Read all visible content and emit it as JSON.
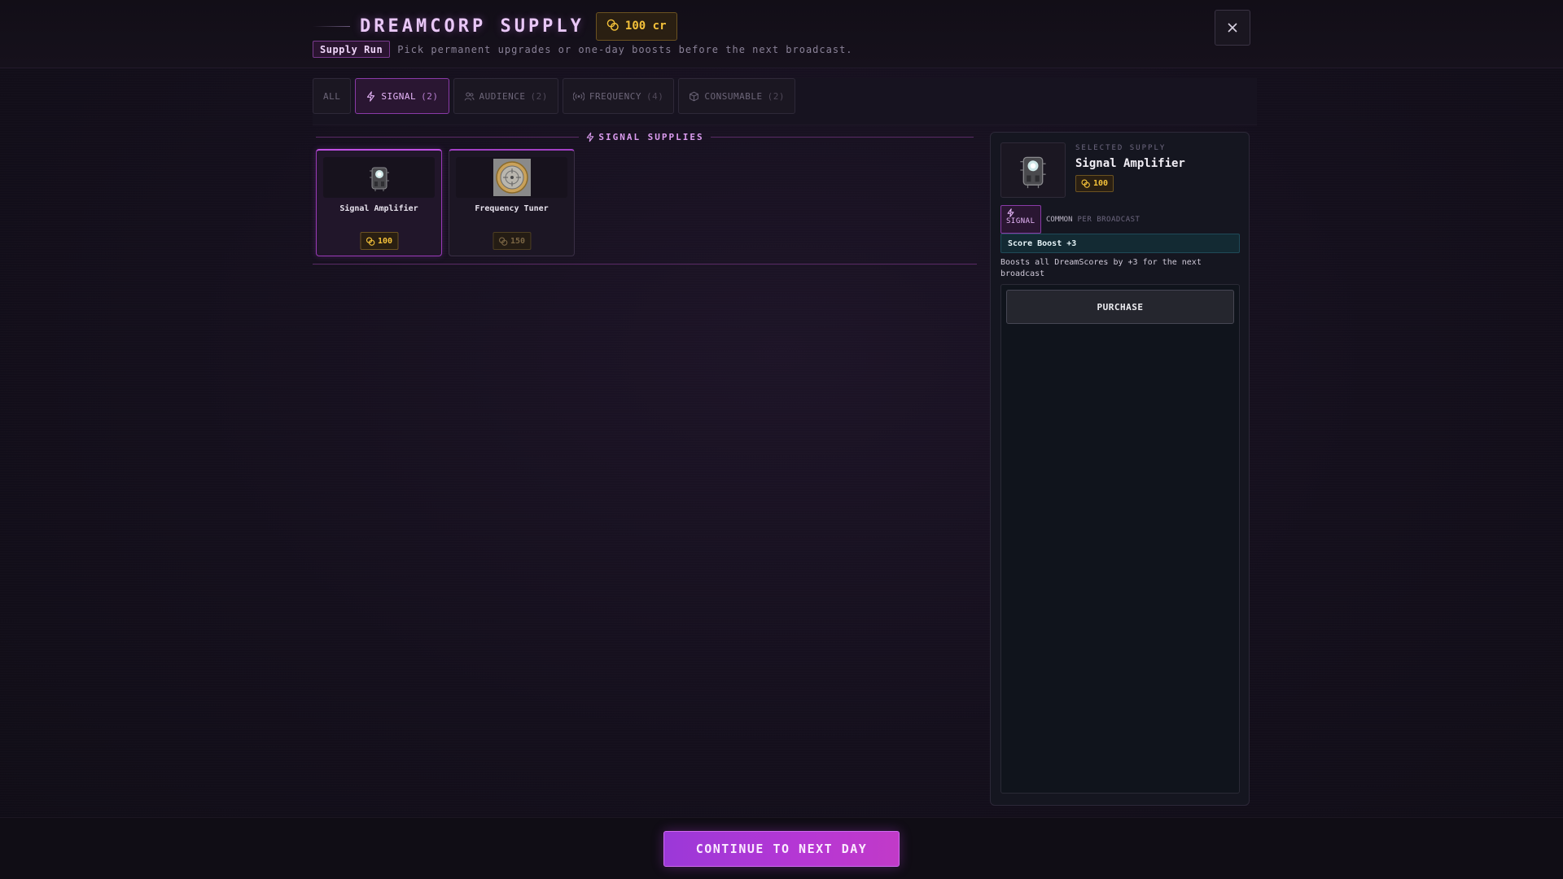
{
  "header": {
    "title": "DREAMCORP SUPPLY",
    "credits": "100 cr",
    "mode_badge": "Supply Run",
    "subtitle": "Pick permanent upgrades or one-day boosts before the next broadcast.",
    "close_label": "✕"
  },
  "tabs": [
    {
      "label": "ALL",
      "count": "",
      "icon": "none",
      "active": false
    },
    {
      "label": "SIGNAL",
      "count": "(2)",
      "icon": "lightning-icon",
      "active": true
    },
    {
      "label": "AUDIENCE",
      "count": "(2)",
      "icon": "users-icon",
      "active": false
    },
    {
      "label": "FREQUENCY",
      "count": "(4)",
      "icon": "broadcast-icon",
      "active": false
    },
    {
      "label": "CONSUMABLE",
      "count": "(2)",
      "icon": "box-icon",
      "active": false
    }
  ],
  "section": {
    "title": "SIGNAL SUPPLIES",
    "icon": "lightning-icon"
  },
  "items": [
    {
      "name": "Signal Amplifier",
      "price": "100",
      "icon": "amplifier-device-icon",
      "selected": true,
      "affordable": true
    },
    {
      "name": "Frequency Tuner",
      "price": "150",
      "icon": "tuner-dial-icon",
      "selected": false,
      "affordable": false
    }
  ],
  "detail": {
    "label": "SELECTED SUPPLY",
    "name": "Signal Amplifier",
    "price": "100",
    "type_tag": "SIGNAL",
    "rarity": "COMMON",
    "duration": "PER BROADCAST",
    "effect": "Score Boost +3",
    "description": "Boosts all DreamScores by +3 for the next broadcast",
    "purchase_label": "PURCHASE"
  },
  "footer": {
    "continue_label": "CONTINUE TO NEXT DAY"
  },
  "colors": {
    "accent": "#c050e4",
    "gold": "#f5c23a",
    "background": "#140f1c"
  }
}
